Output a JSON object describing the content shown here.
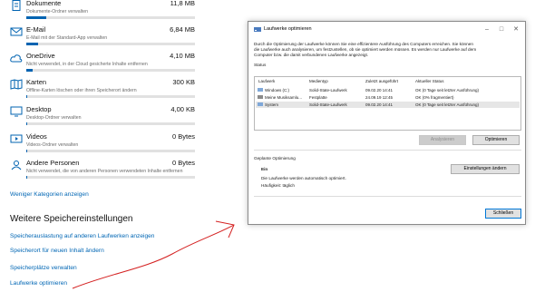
{
  "categories": [
    {
      "name": "Dokumente",
      "size": "11,8 MB",
      "desc": "Dokumente-Ordner verwalten",
      "fill": 0.12,
      "icon": "documents-icon"
    },
    {
      "name": "E-Mail",
      "size": "6,84 MB",
      "desc": "E-Mail mit der Standard-App verwalten",
      "fill": 0.07,
      "icon": "mail-icon"
    },
    {
      "name": "OneDrive",
      "size": "4,10 MB",
      "desc": "Nicht verwendet, in der Cloud gesicherte Inhalte entfernen",
      "fill": 0.04,
      "icon": "cloud-icon"
    },
    {
      "name": "Karten",
      "size": "300 KB",
      "desc": "Offline-Karten löschen oder ihren Speicherort ändern",
      "fill": 0.0,
      "icon": "map-icon"
    },
    {
      "name": "Desktop",
      "size": "4,00 KB",
      "desc": "Desktop-Ordner verwalten",
      "fill": 0.0,
      "icon": "desktop-icon"
    },
    {
      "name": "Videos",
      "size": "0 Bytes",
      "desc": "Videos-Ordner verwalten",
      "fill": 0.0,
      "icon": "video-icon"
    },
    {
      "name": "Andere Personen",
      "size": "0 Bytes",
      "desc": "Nicht verwendet, die von anderen Personen verwendeten Inhalte entfernen",
      "fill": 0.0,
      "icon": "people-icon"
    }
  ],
  "more_categories_link": "Weniger Kategorien anzeigen",
  "settings_heading": "Weitere Speichereinstellungen",
  "settings_links": [
    "Speicherauslastung auf anderen Laufwerken anzeigen",
    "Speicherort für neuen Inhalt ändern",
    "Speicherplätze verwalten",
    "Laufwerke optimieren"
  ],
  "dialog": {
    "title": "Laufwerke optimieren",
    "intro": [
      "Durch die Optimierung der Laufwerke können Sie eine effizientere Ausführung des Computers erreichen. Sie können",
      "die Laufwerke auch analysieren, um festzustellen, ob sie optimiert werden müssen. Es werden nur Laufwerke auf dem",
      "Computer bzw. die damit verbundenen Laufwerke angezeigt."
    ],
    "status_label": "Status",
    "columns": [
      "Laufwerk",
      "Medientyp",
      "Zuletzt ausgeführt",
      "Aktueller Status"
    ],
    "rows": [
      {
        "drive": "Windows (C:)",
        "media": "Solid-State-Laufwerk",
        "last": "09.02.20 14:41",
        "status": "OK (0 Tage seit letzter Ausführung)"
      },
      {
        "drive": "Meine Musiksamlu...",
        "media": "Festplatte",
        "last": "24.09.19 12:45",
        "status": "OK (0% fragmentiert)"
      },
      {
        "drive": "System",
        "media": "Solid-State-Laufwerk",
        "last": "09.02.20 14:41",
        "status": "OK (0 Tage seit letzter Ausführung)"
      }
    ],
    "analyze_button": "Analysieren",
    "optimize_button": "Optimieren",
    "scheduled_label": "Geplante Optimierung",
    "schedule_state": "Ein",
    "schedule_desc": "Die Laufwerke werden automatisch optimiert.",
    "frequency": "Häufigkeit: täglich",
    "change_settings_button": "Einstellungen ändern",
    "close_button": "Schließen"
  },
  "colors": {
    "accent": "#0066b4",
    "annotation": "#d42020"
  }
}
